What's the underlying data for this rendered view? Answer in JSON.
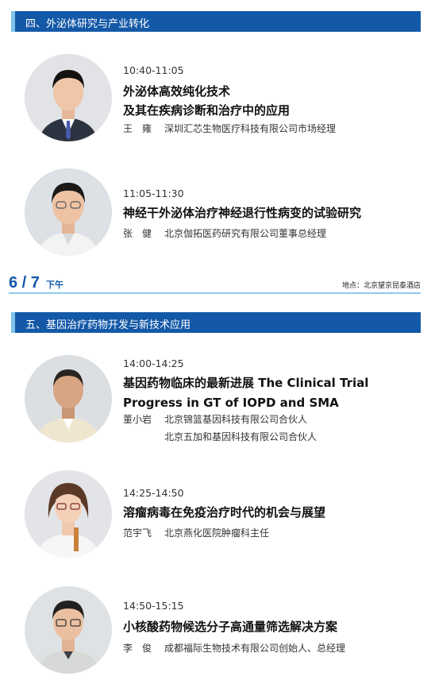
{
  "section4": {
    "title": "四、外泌体研究与产业转化"
  },
  "section5": {
    "title": "五、基因治疗药物开发与新技术应用"
  },
  "date_bar": {
    "date": "6 / 7",
    "period": "下午",
    "venue": "地点：北京望京昆泰酒店"
  },
  "talks": [
    {
      "time": "10:40-11:05",
      "title_lines": [
        "外泌体高效纯化技术",
        "及其在疾病诊断和治疗中的应用"
      ],
      "speakers": [
        {
          "name": "王　雍",
          "affiliation": "深圳汇芯生物医疗科技有限公司市场经理"
        }
      ]
    },
    {
      "time": "11:05-11:30",
      "title_lines": [
        "神经干外泌体治疗神经退行性病变的试验研究"
      ],
      "speakers": [
        {
          "name": "张　健",
          "affiliation": "北京伽拓医药研究有限公司董事总经理"
        }
      ]
    },
    {
      "time": "14:00-14:25",
      "title_lines": [
        "基因药物临床的最新进展 The Clinical Trial",
        "Progress in GT of IOPD and SMA"
      ],
      "speakers": [
        {
          "name": "董小岩",
          "affiliation": "北京锦篮基因科技有限公司合伙人"
        },
        {
          "name": "",
          "affiliation": "北京五加和基因科技有限公司合伙人"
        }
      ]
    },
    {
      "time": "14:25-14:50",
      "title_lines": [
        "溶瘤病毒在免疫治疗时代的机会与展望"
      ],
      "speakers": [
        {
          "name": "范宇飞",
          "affiliation": "北京燕化医院肿瘤科主任"
        }
      ]
    },
    {
      "time": "14:50-15:15",
      "title_lines": [
        "小核酸药物候选分子高通量筛选解决方案"
      ],
      "speakers": [
        {
          "name": "李　俊",
          "affiliation": "成都福际生物技术有限公司创始人、总经理"
        }
      ]
    }
  ],
  "colors": {
    "header_bar": "#1459a8",
    "accent": "#7fc3ea",
    "date": "#1459a8"
  }
}
